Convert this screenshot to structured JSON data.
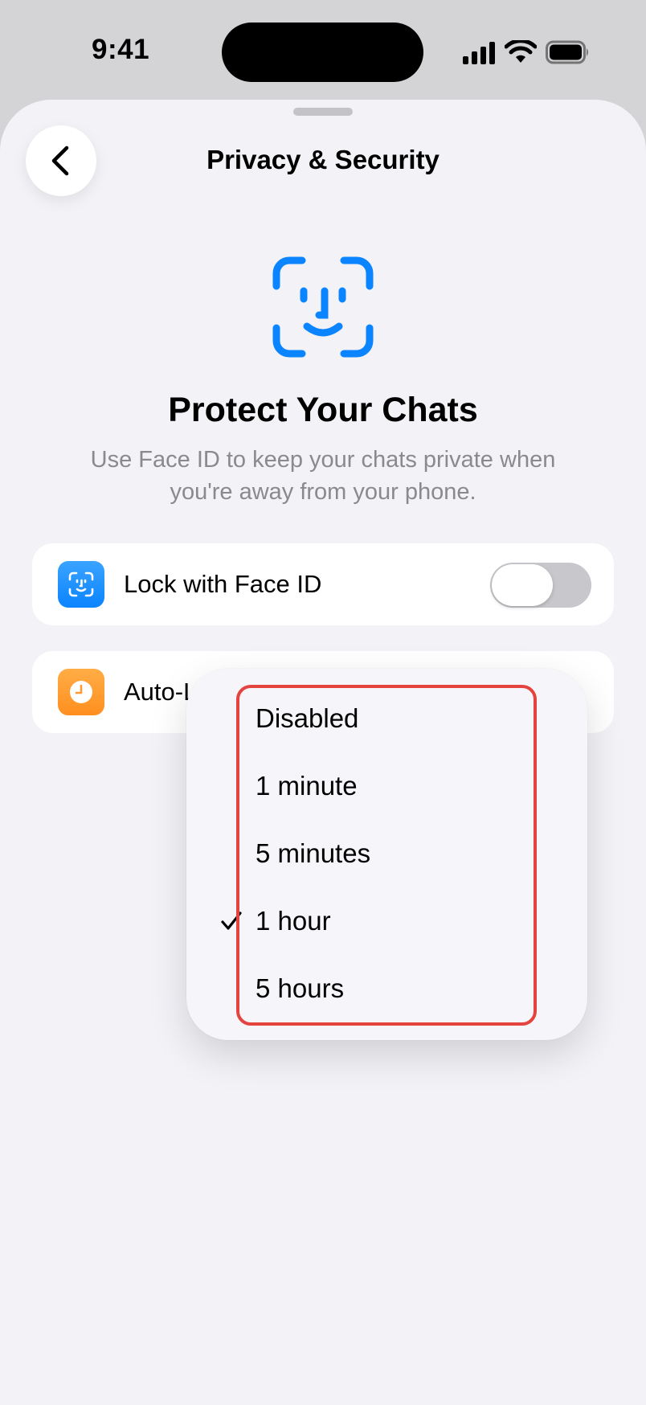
{
  "status_bar": {
    "time": "9:41",
    "icons": [
      "cellular-signal-icon",
      "wifi-icon",
      "battery-icon"
    ]
  },
  "nav": {
    "title": "Privacy & Security",
    "back_icon": "chevron-left-icon"
  },
  "hero": {
    "icon": "face-id-icon",
    "title": "Protect Your Chats",
    "subtitle": "Use Face ID to keep your chats private when you're away from your phone."
  },
  "settings": {
    "face_id": {
      "label": "Lock with Face ID",
      "icon": "face-id-icon",
      "toggle_on": false
    },
    "auto_lock": {
      "label": "Auto-L",
      "icon": "clock-icon"
    }
  },
  "menu": {
    "options": [
      "Disabled",
      "1 minute",
      "5 minutes",
      "1 hour",
      "5 hours"
    ],
    "selected": "1 hour"
  },
  "colors": {
    "accent": "#0a84ff",
    "orange": "#ff9a30",
    "highlight": "#e5433e",
    "background": "#f2f2f7"
  }
}
